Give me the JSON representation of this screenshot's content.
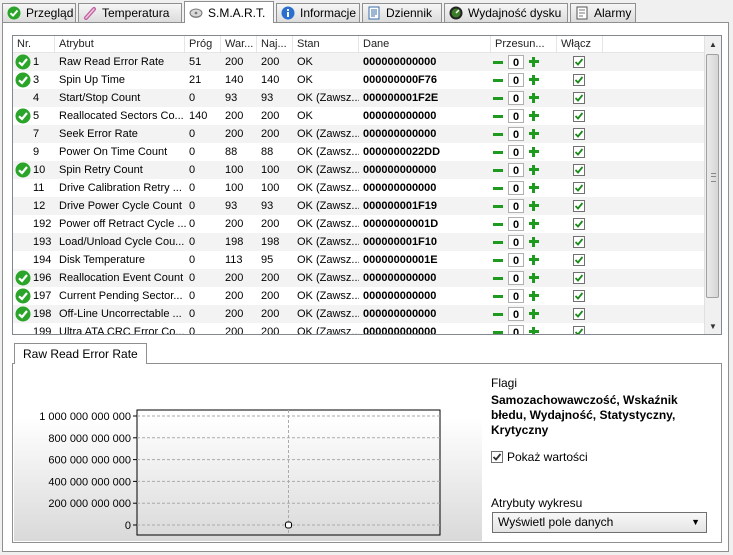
{
  "tabs": [
    {
      "label": "Przegląd",
      "icon": "check-circle-icon"
    },
    {
      "label": "Temperatura",
      "icon": "thermometer-icon"
    },
    {
      "label": "S.M.A.R.T.",
      "icon": "smart-disk-icon"
    },
    {
      "label": "Informacje",
      "icon": "info-icon"
    },
    {
      "label": "Dziennik",
      "icon": "document-icon"
    },
    {
      "label": "Wydajność dysku",
      "icon": "speedometer-icon"
    },
    {
      "label": "Alarmy",
      "icon": "alarm-document-icon"
    }
  ],
  "active_tab": "S.M.A.R.T.",
  "grid": {
    "headers": {
      "nr": "Nr.",
      "atrybut": "Atrybut",
      "prog": "Próg",
      "war": "War...",
      "naj": "Naj...",
      "stan": "Stan",
      "dane": "Dane",
      "przesun": "Przesun...",
      "wlacz": "Włącz"
    },
    "rows": [
      {
        "nr": "1",
        "atrybut": "Raw Read Error Rate",
        "prog": "51",
        "war": "200",
        "naj": "200",
        "stan": "OK",
        "dane": "000000000000",
        "offset": "0",
        "critical": true,
        "enabled": true
      },
      {
        "nr": "3",
        "atrybut": "Spin Up Time",
        "prog": "21",
        "war": "140",
        "naj": "140",
        "stan": "OK",
        "dane": "000000000F76",
        "offset": "0",
        "critical": true,
        "enabled": true
      },
      {
        "nr": "4",
        "atrybut": "Start/Stop Count",
        "prog": "0",
        "war": "93",
        "naj": "93",
        "stan": "OK (Zawsz...",
        "dane": "000000001F2E",
        "offset": "0",
        "critical": false,
        "enabled": true
      },
      {
        "nr": "5",
        "atrybut": "Reallocated Sectors Co...",
        "prog": "140",
        "war": "200",
        "naj": "200",
        "stan": "OK",
        "dane": "000000000000",
        "offset": "0",
        "critical": true,
        "enabled": true
      },
      {
        "nr": "7",
        "atrybut": "Seek Error Rate",
        "prog": "0",
        "war": "200",
        "naj": "200",
        "stan": "OK (Zawsz...",
        "dane": "000000000000",
        "offset": "0",
        "critical": false,
        "enabled": true
      },
      {
        "nr": "9",
        "atrybut": "Power On Time Count",
        "prog": "0",
        "war": "88",
        "naj": "88",
        "stan": "OK (Zawsz...",
        "dane": "0000000022DD",
        "offset": "0",
        "critical": false,
        "enabled": true
      },
      {
        "nr": "10",
        "atrybut": "Spin Retry Count",
        "prog": "0",
        "war": "100",
        "naj": "100",
        "stan": "OK (Zawsz...",
        "dane": "000000000000",
        "offset": "0",
        "critical": true,
        "enabled": true
      },
      {
        "nr": "11",
        "atrybut": "Drive Calibration Retry ...",
        "prog": "0",
        "war": "100",
        "naj": "100",
        "stan": "OK (Zawsz...",
        "dane": "000000000000",
        "offset": "0",
        "critical": false,
        "enabled": true
      },
      {
        "nr": "12",
        "atrybut": "Drive Power Cycle Count",
        "prog": "0",
        "war": "93",
        "naj": "93",
        "stan": "OK (Zawsz...",
        "dane": "000000001F19",
        "offset": "0",
        "critical": false,
        "enabled": true
      },
      {
        "nr": "192",
        "atrybut": "Power off Retract Cycle ...",
        "prog": "0",
        "war": "200",
        "naj": "200",
        "stan": "OK (Zawsz...",
        "dane": "00000000001D",
        "offset": "0",
        "critical": false,
        "enabled": true
      },
      {
        "nr": "193",
        "atrybut": "Load/Unload Cycle Cou...",
        "prog": "0",
        "war": "198",
        "naj": "198",
        "stan": "OK (Zawsz...",
        "dane": "000000001F10",
        "offset": "0",
        "critical": false,
        "enabled": true
      },
      {
        "nr": "194",
        "atrybut": "Disk Temperature",
        "prog": "0",
        "war": "113",
        "naj": "95",
        "stan": "OK (Zawsz...",
        "dane": "00000000001E",
        "offset": "0",
        "critical": false,
        "enabled": true
      },
      {
        "nr": "196",
        "atrybut": "Reallocation Event Count",
        "prog": "0",
        "war": "200",
        "naj": "200",
        "stan": "OK (Zawsz...",
        "dane": "000000000000",
        "offset": "0",
        "critical": true,
        "enabled": true
      },
      {
        "nr": "197",
        "atrybut": "Current Pending Sector...",
        "prog": "0",
        "war": "200",
        "naj": "200",
        "stan": "OK (Zawsz...",
        "dane": "000000000000",
        "offset": "0",
        "critical": true,
        "enabled": true
      },
      {
        "nr": "198",
        "atrybut": "Off-Line Uncorrectable ...",
        "prog": "0",
        "war": "200",
        "naj": "200",
        "stan": "OK (Zawsz...",
        "dane": "000000000000",
        "offset": "0",
        "critical": true,
        "enabled": true
      },
      {
        "nr": "199",
        "atrybut": "Ultra ATA CRC Error Co...",
        "prog": "0",
        "war": "200",
        "naj": "200",
        "stan": "OK (Zawsz...",
        "dane": "000000000000",
        "offset": "0",
        "critical": false,
        "enabled": true
      }
    ]
  },
  "detail": {
    "tab_label": "Raw Read Error Rate",
    "flags_label": "Flagi",
    "flags_value": "Samozachowawczość, Wskaźnik błedu, Wydajność, Statystyczny, Krytyczny",
    "show_values_label": "Pokaż wartości",
    "show_values_checked": true,
    "chart_attr_label": "Atrybuty wykresu",
    "chart_attr_value": "Wyświetl pole danych"
  },
  "chart_data": {
    "type": "line",
    "series": [
      {
        "values": [
          0
        ]
      }
    ],
    "y_ticks": [
      "1 000 000 000 000",
      "800 000 000 000",
      "600 000 000 000",
      "400 000 000 000",
      "200 000 000 000",
      "0"
    ],
    "ylim": [
      0,
      1000000000000
    ],
    "grid": true,
    "colors": {
      "grid": "#aaaaaa",
      "axis": "#000000"
    }
  },
  "colors": {
    "ok_green": "#2aa52a",
    "stepper_green": "#1e9b1e",
    "check_green": "#1b8a1b",
    "alt_row": "#f3f3f3"
  }
}
